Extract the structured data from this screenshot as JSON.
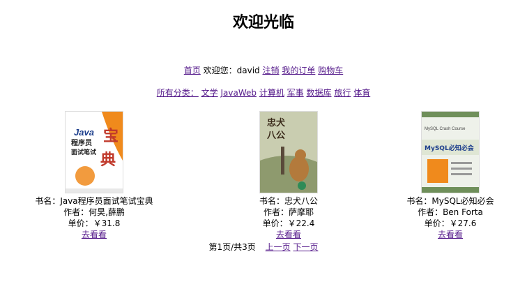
{
  "page": {
    "title": "欢迎光临"
  },
  "nav": {
    "home": "首页",
    "welcome_prefix": "欢迎您：",
    "username": "david",
    "logout": "注销",
    "orders": "我的订单",
    "cart": "购物车"
  },
  "categories": {
    "label": "所有分类：",
    "items": [
      "文学",
      "JavaWeb",
      "计算机",
      "军事",
      "数据库",
      "旅行",
      "体育"
    ]
  },
  "books": [
    {
      "name": "书名：Java程序员面试笔试宝典",
      "author": "作者：何昊,薛鹏",
      "price": "单价：￥31.8",
      "link": "去看看",
      "cover_text": [
        "Java",
        "程序员",
        "面试笔试",
        "宝",
        "典"
      ]
    },
    {
      "name": "书名：忠犬八公",
      "author": "作者：萨摩耶",
      "price": "单价：￥22.4",
      "link": "去看看",
      "cover_text": [
        "忠犬",
        "八公"
      ]
    },
    {
      "name": "书名：MySQL必知必会",
      "author": "作者：Ben Forta",
      "price": "单价：￥27.6",
      "link": "去看看",
      "cover_text": [
        "MySQL Crash Course",
        "MySQL必知必会"
      ]
    }
  ],
  "pager": {
    "status": "第1页/共3页",
    "prev": "上一页",
    "next": "下一页"
  },
  "colors": {
    "link": "#551a8b",
    "java_orange": "#f08a1c",
    "java_blue": "#1c3e8c",
    "hachi_bg": "#c9cdb0",
    "mysql_green": "#6f8f5a"
  }
}
